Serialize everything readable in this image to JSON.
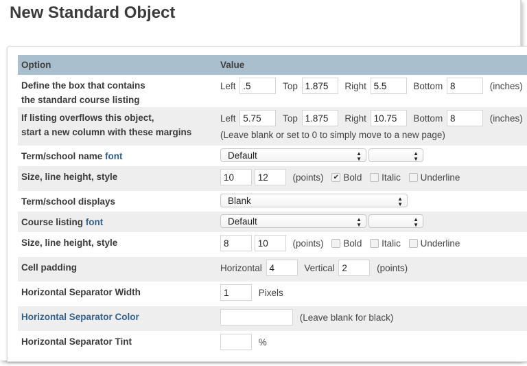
{
  "page": {
    "title": "New Standard Object"
  },
  "table": {
    "headers": {
      "option": "Option",
      "value": "Value"
    },
    "rows": {
      "box": {
        "label_line1": "Define the box that contains",
        "label_line2": "the standard course listing",
        "left_label": "Left",
        "left": ".5",
        "top_label": "Top",
        "top": "1.875",
        "right_label": "Right",
        "right": "5.5",
        "bottom_label": "Bottom",
        "bottom": "8",
        "unit": "(inches)"
      },
      "overflow": {
        "label_line1": "If listing overflows this object,",
        "label_line2": "start a new column with these margins",
        "left_label": "Left",
        "left": "5.75",
        "top_label": "Top",
        "top": "1.875",
        "right_label": "Right",
        "right": "10.75",
        "bottom_label": "Bottom",
        "bottom": "8",
        "unit": "(inches)",
        "note": "(Leave blank or set to 0 to simply move to a new page)"
      },
      "term_font": {
        "label": "Term/school name ",
        "link": "font",
        "font_select": "Default",
        "style_select": ""
      },
      "term_size": {
        "label": "Size, line height, style",
        "size": "10",
        "line_height": "12",
        "unit": "(points)",
        "bold_label": "Bold",
        "bold": true,
        "italic_label": "Italic",
        "italic": false,
        "underline_label": "Underline",
        "underline": false
      },
      "term_displays": {
        "label": "Term/school displays",
        "select": "Blank"
      },
      "course_font": {
        "label": "Course listing ",
        "link": "font",
        "font_select": "Default",
        "style_select": ""
      },
      "course_size": {
        "label": "Size, line height, style",
        "size": "8",
        "line_height": "10",
        "unit": "(points)",
        "bold_label": "Bold",
        "bold": false,
        "italic_label": "Italic",
        "italic": false,
        "underline_label": "Underline",
        "underline": false
      },
      "cell_padding": {
        "label": "Cell padding",
        "horizontal_label": "Horizontal",
        "horizontal": "4",
        "vertical_label": "Vertical",
        "vertical": "2",
        "unit": "(points)"
      },
      "sep_width": {
        "label": "Horizontal Separator Width",
        "value": "1",
        "unit": "Pixels"
      },
      "sep_color": {
        "label": "Horizontal Separator Color",
        "value": "",
        "note": "(Leave blank for black)"
      },
      "sep_tint": {
        "label": "Horizontal Separator Tint",
        "value": "",
        "unit": "%"
      }
    }
  },
  "icons": {
    "select_arrows": "up-down-arrows-icon",
    "checkmark": "✔"
  },
  "colors": {
    "header_bg": "#a9bfcd",
    "link": "#33608a",
    "alt_row": "#eeeeee"
  }
}
